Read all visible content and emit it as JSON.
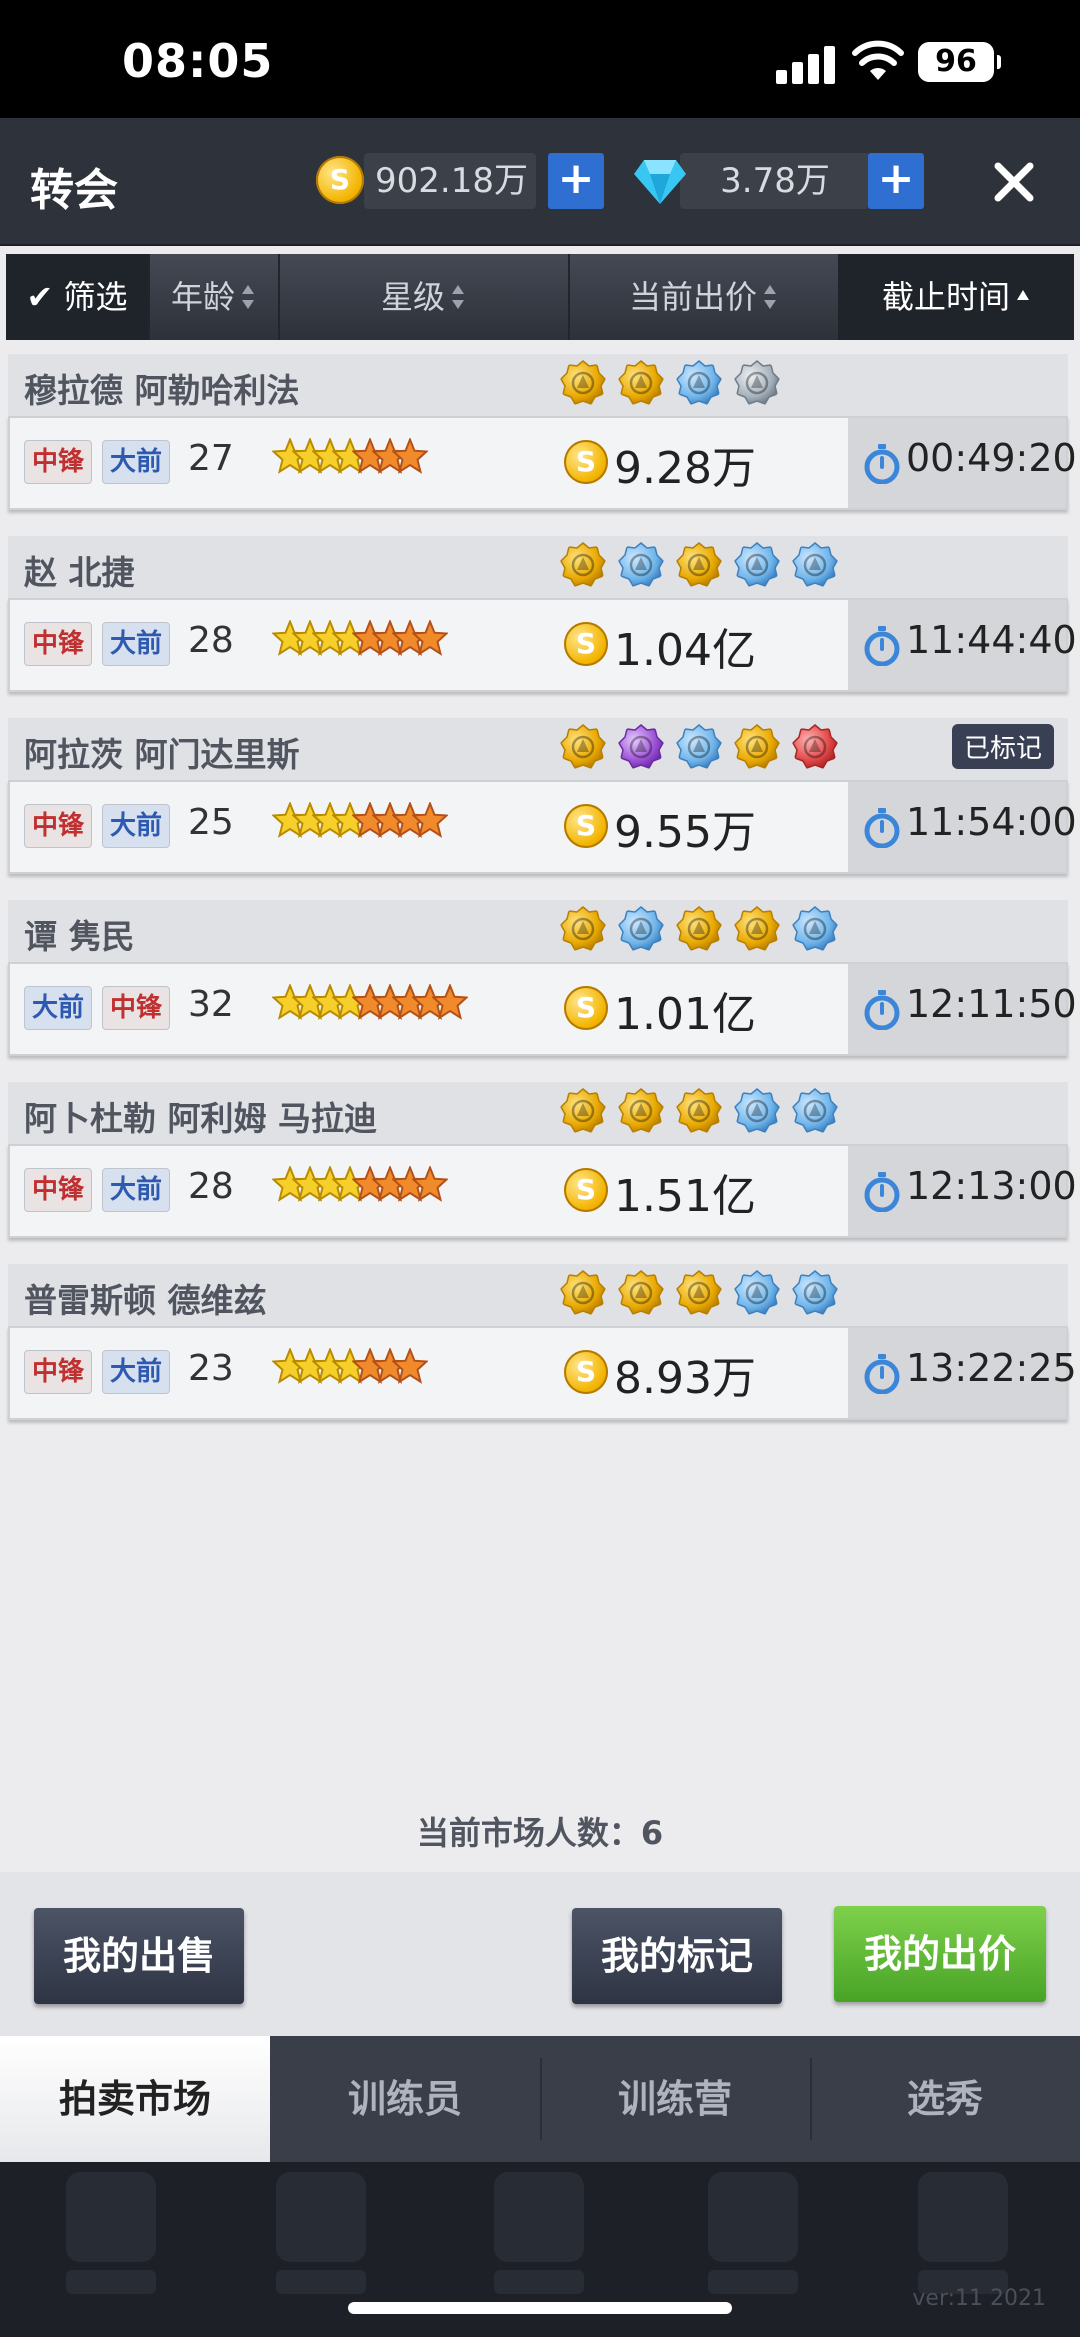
{
  "status_bar": {
    "time": "08:05",
    "battery": "96"
  },
  "header": {
    "title": "转会",
    "gold": "902.18万",
    "diamond": "3.78万",
    "coin_symbol": "S"
  },
  "filter_bar": {
    "filter_label": "筛选",
    "columns": [
      "年龄",
      "星级",
      "当前出价",
      "截止时间"
    ]
  },
  "players": [
    {
      "name": "穆拉德 阿勒哈利法",
      "positions": [
        "中锋",
        "大前"
      ],
      "age": "27",
      "stars_gold": 4,
      "stars_orange": 3,
      "price": "9.28万",
      "time": "00:49:20",
      "badge": "",
      "skills": [
        "gold",
        "gold",
        "blue",
        "silver"
      ]
    },
    {
      "name": "赵 北捷",
      "positions": [
        "中锋",
        "大前"
      ],
      "age": "28",
      "stars_gold": 4,
      "stars_orange": 4,
      "price": "1.04亿",
      "time": "11:44:40",
      "badge": "",
      "skills": [
        "gold",
        "blue",
        "gold",
        "blue",
        "blue"
      ]
    },
    {
      "name": "阿拉茨 阿门达里斯",
      "positions": [
        "中锋",
        "大前"
      ],
      "age": "25",
      "stars_gold": 4,
      "stars_orange": 4,
      "price": "9.55万",
      "time": "11:54:00",
      "badge": "已标记",
      "skills": [
        "gold",
        "purple",
        "blue",
        "gold",
        "red"
      ]
    },
    {
      "name": "谭 隽民",
      "positions": [
        "大前",
        "中锋"
      ],
      "age": "32",
      "stars_gold": 4,
      "stars_orange": 5,
      "price": "1.01亿",
      "time": "12:11:50",
      "badge": "",
      "skills": [
        "gold",
        "blue",
        "gold",
        "gold",
        "blue"
      ]
    },
    {
      "name": "阿卜杜勒 阿利姆 马拉迪",
      "positions": [
        "中锋",
        "大前"
      ],
      "age": "28",
      "stars_gold": 4,
      "stars_orange": 4,
      "price": "1.51亿",
      "time": "12:13:00",
      "badge": "",
      "skills": [
        "gold",
        "gold",
        "gold",
        "blue",
        "blue"
      ]
    },
    {
      "name": "普雷斯顿 德维兹",
      "positions": [
        "中锋",
        "大前"
      ],
      "age": "23",
      "stars_gold": 4,
      "stars_orange": 3,
      "price": "8.93万",
      "time": "13:22:25",
      "badge": "",
      "skills": [
        "gold",
        "gold",
        "gold",
        "blue",
        "blue"
      ]
    }
  ],
  "market_count": "当前市场人数：6",
  "actions": {
    "my_sales": "我的出售",
    "my_marks": "我的标记",
    "my_bids": "我的出价"
  },
  "tabs": [
    "拍卖市场",
    "训练员",
    "训练营",
    "选秀"
  ],
  "version": "ver:11  2021",
  "colors": {
    "accent_blue": "#2f6fd2",
    "green": "#5cb832",
    "header": "#2d323b"
  }
}
